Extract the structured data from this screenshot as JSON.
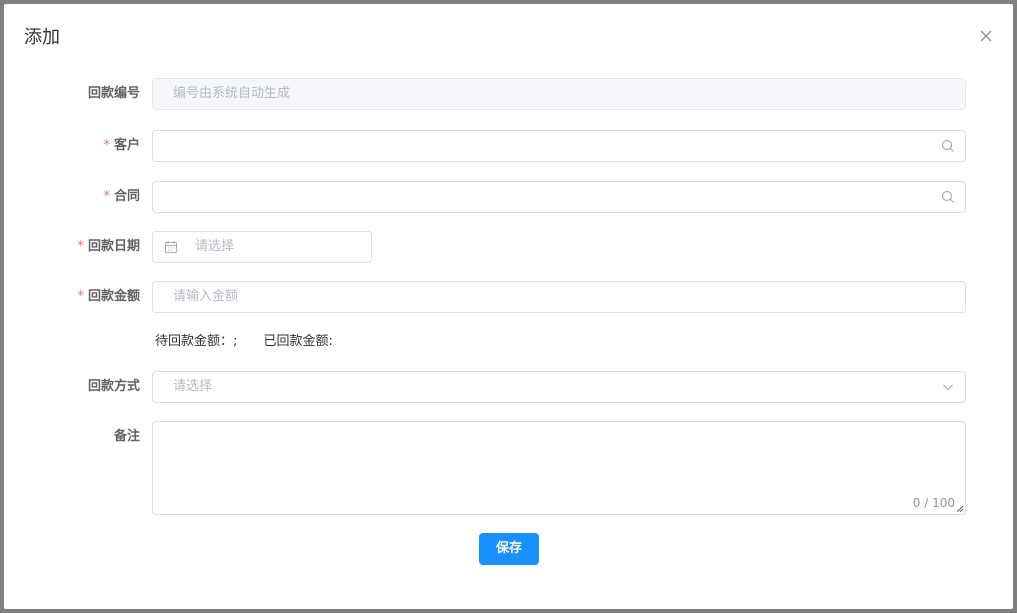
{
  "dialog": {
    "title": "添加",
    "close_icon": "close-icon"
  },
  "form": {
    "payment_no": {
      "label": "回款编号",
      "placeholder": "编号由系统自动生成"
    },
    "customer": {
      "label": "客户",
      "required_mark": "*",
      "value": "",
      "icon": "search-icon"
    },
    "contract": {
      "label": "合同",
      "required_mark": "*",
      "value": "",
      "icon": "search-icon"
    },
    "payment_date": {
      "label": "回款日期",
      "required_mark": "*",
      "placeholder": "请选择",
      "icon": "calendar-icon"
    },
    "payment_amount": {
      "label": "回款金额",
      "required_mark": "*",
      "placeholder": "请输入金额"
    },
    "summary": {
      "pending": "待回款金额：;",
      "received": "已回款金额:"
    },
    "payment_method": {
      "label": "回款方式",
      "placeholder": "请选择",
      "icon": "chevron-down-icon"
    },
    "remark": {
      "label": "备注",
      "counter": "0 / 100"
    },
    "save_label": "保存"
  },
  "colors": {
    "primary": "#1890ff",
    "required": "#f56c6c",
    "border": "#dcdfe6",
    "disabled_bg": "#f5f7fa"
  }
}
